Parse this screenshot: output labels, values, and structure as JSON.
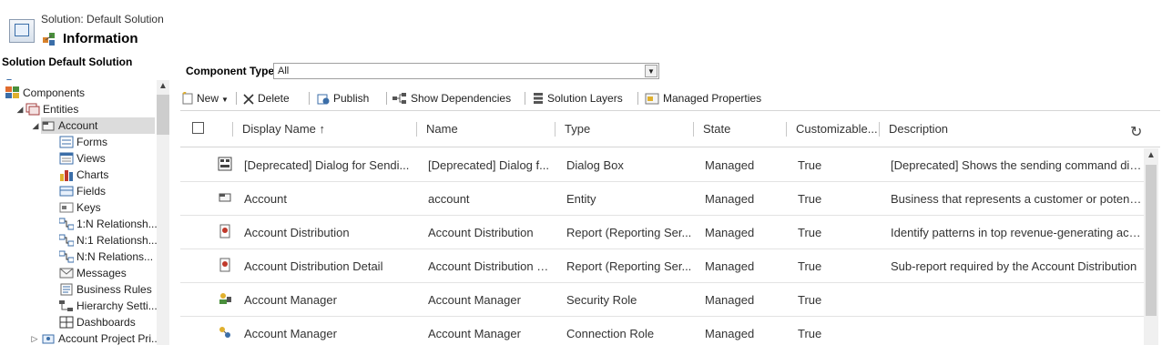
{
  "header": {
    "subtitle": "Solution: Default Solution",
    "title": "Information"
  },
  "nav": {
    "title": "Solution Default Solution",
    "items": [
      {
        "label": "Components",
        "icon": "components-icon"
      },
      {
        "label": "Entities",
        "icon": "entities-icon"
      },
      {
        "label": "Account",
        "icon": "entity-icon"
      },
      {
        "label": "Forms",
        "icon": "forms-icon"
      },
      {
        "label": "Views",
        "icon": "views-icon"
      },
      {
        "label": "Charts",
        "icon": "charts-icon"
      },
      {
        "label": "Fields",
        "icon": "fields-icon"
      },
      {
        "label": "Keys",
        "icon": "keys-icon"
      },
      {
        "label": "1:N Relationsh...",
        "icon": "relationship-icon"
      },
      {
        "label": "N:1 Relationsh...",
        "icon": "relationship-icon"
      },
      {
        "label": "N:N Relations...",
        "icon": "relationship-icon"
      },
      {
        "label": "Messages",
        "icon": "messages-icon"
      },
      {
        "label": "Business Rules",
        "icon": "business-rules-icon"
      },
      {
        "label": "Hierarchy Setti...",
        "icon": "hierarchy-icon"
      },
      {
        "label": "Dashboards",
        "icon": "dashboards-icon"
      },
      {
        "label": "Account Project Pri...",
        "icon": "entity-icon"
      }
    ]
  },
  "component_type": {
    "label": "Component Type",
    "value": "All"
  },
  "toolbar": {
    "new_label": "New",
    "delete_label": "Delete",
    "publish_label": "Publish",
    "show_dependencies_label": "Show Dependencies",
    "solution_layers_label": "Solution Layers",
    "managed_properties_label": "Managed Properties"
  },
  "grid": {
    "columns": {
      "display_name": "Display Name ↑",
      "name": "Name",
      "type": "Type",
      "state": "State",
      "customizable": "Customizable...",
      "description": "Description"
    },
    "rows": [
      {
        "display_name": "[Deprecated] Dialog for Sendi...",
        "name": "[Deprecated] Dialog f...",
        "type": "Dialog Box",
        "state": "Managed",
        "customizable": "True",
        "description": "[Deprecated] Shows the sending command dial...",
        "icon": "dialog-icon"
      },
      {
        "display_name": "Account",
        "name": "account",
        "type": "Entity",
        "state": "Managed",
        "customizable": "True",
        "description": "Business that represents a customer or potentia...",
        "icon": "entity-icon"
      },
      {
        "display_name": "Account Distribution",
        "name": "Account Distribution",
        "type": "Report (Reporting Ser...",
        "state": "Managed",
        "customizable": "True",
        "description": "Identify patterns in top revenue-generating acc...",
        "icon": "report-icon"
      },
      {
        "display_name": "Account Distribution Detail",
        "name": "Account Distribution D...",
        "type": "Report (Reporting Ser...",
        "state": "Managed",
        "customizable": "True",
        "description": "Sub-report required by the Account Distribution",
        "icon": "report-icon"
      },
      {
        "display_name": "Account Manager",
        "name": "Account Manager",
        "type": "Security Role",
        "state": "Managed",
        "customizable": "True",
        "description": "",
        "icon": "security-role-icon"
      },
      {
        "display_name": "Account Manager",
        "name": "Account Manager",
        "type": "Connection Role",
        "state": "Managed",
        "customizable": "True",
        "description": "",
        "icon": "connection-role-icon"
      }
    ]
  }
}
